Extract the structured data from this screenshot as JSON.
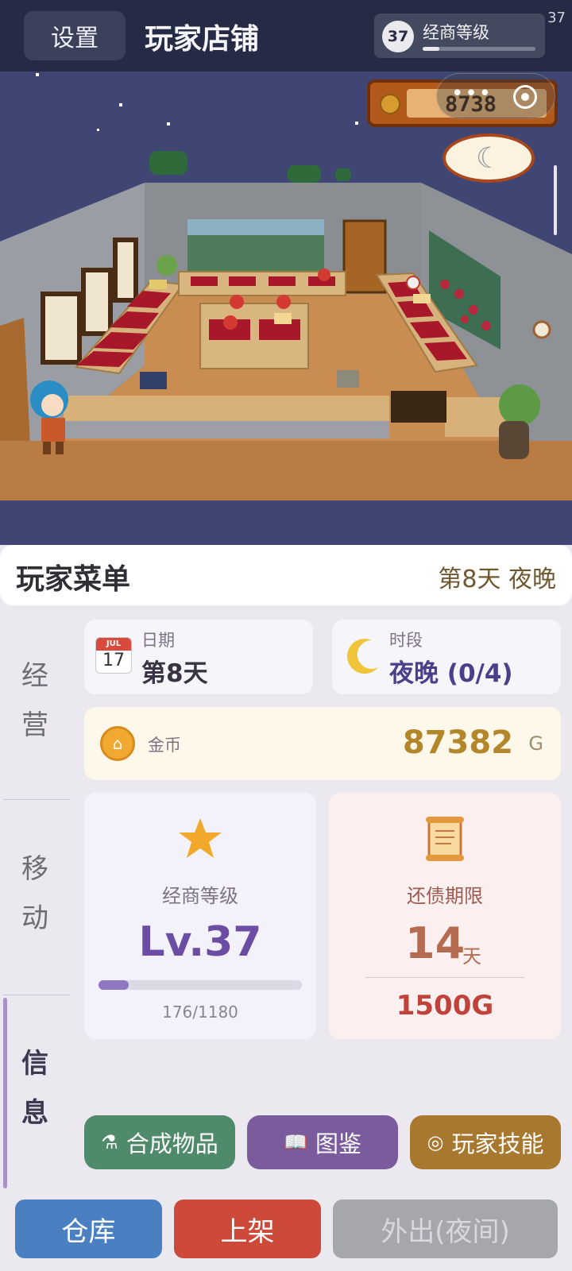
{
  "topbar": {
    "settings_label": "设置",
    "title": "玩家店铺",
    "level_badge": "37",
    "level_label": "经商等级",
    "level_progress": 0.149,
    "corner_value": "37"
  },
  "scene": {
    "coin_display": "8738",
    "capsule_dots": "•••",
    "moon_glyph": "☾",
    "icons": [
      "coin-icon",
      "more-dots-icon",
      "target-icon",
      "moon-sign-icon"
    ]
  },
  "panel": {
    "title": "玩家菜单",
    "daytime": "第8天 夜晚",
    "tabs": [
      {
        "chars": [
          "经",
          "营"
        ]
      },
      {
        "chars": [
          "移",
          "动"
        ]
      },
      {
        "chars": [
          "信",
          "息"
        ]
      }
    ],
    "active_tab": 2,
    "date": {
      "label": "日期",
      "value": "第8天",
      "calendar_month": "JUL",
      "calendar_day": "17"
    },
    "time": {
      "label": "时段",
      "value": "夜晚 (0/4)"
    },
    "gold": {
      "label": "金币",
      "value": "87382",
      "unit": "G"
    },
    "level": {
      "label": "经商等级",
      "value": "Lv.37",
      "progress_text": "176/1180",
      "progress": 0.149
    },
    "debt": {
      "label": "还债期限",
      "days": "14",
      "days_unit": "天",
      "amount": "1500G"
    },
    "actions": [
      {
        "label": "合成物品",
        "icon": "flask-icon",
        "glyph": "⚗"
      },
      {
        "label": "图鉴",
        "icon": "book-icon",
        "glyph": "📖"
      },
      {
        "label": "玩家技能",
        "icon": "target-icon",
        "glyph": "◎"
      }
    ]
  },
  "bottom": {
    "warehouse": "仓库",
    "listing": "上架",
    "go_out": "外出(夜间)"
  },
  "colors": {
    "topbar_bg": "#252b45",
    "warehouse_btn": "#4a80c2",
    "listing_btn": "#cd4a3a",
    "go_out_btn": "#a6a6ad",
    "craft_btn": "#4f8a6a",
    "book_btn": "#7a5b9b",
    "skill_btn": "#a8782e",
    "level_purple": "#6b4ea4",
    "debt_red": "#c0423b"
  }
}
